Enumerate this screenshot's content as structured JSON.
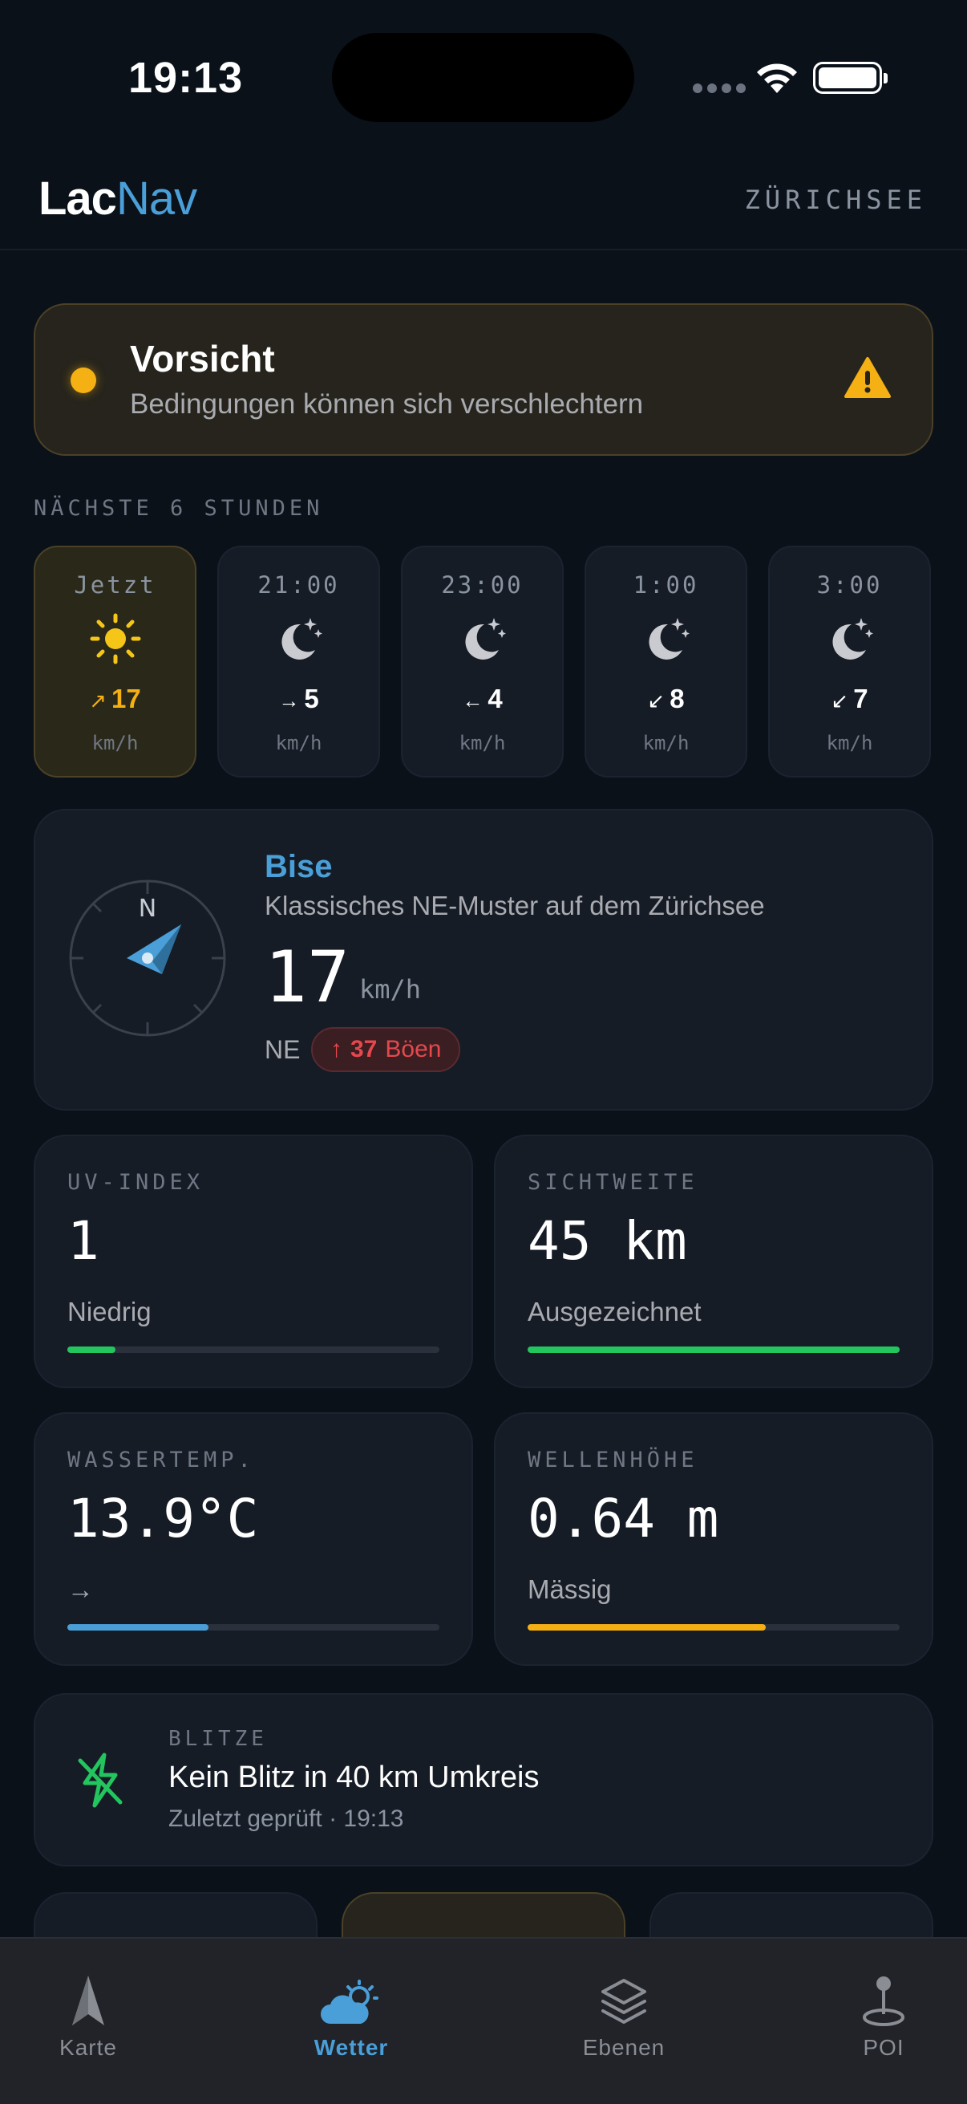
{
  "status": {
    "time": "19:13"
  },
  "header": {
    "logo_a": "Lac",
    "logo_b": "Nav",
    "lake": "ZÜRICHSEE"
  },
  "alert": {
    "title": "Vorsicht",
    "subtitle": "Bedingungen können sich verschlechtern",
    "color": "#f5b014"
  },
  "forecast": {
    "label": "NÄCHSTE 6 STUNDEN",
    "hours": [
      {
        "time": "Jetzt",
        "icon": "sun-icon",
        "arrow": "↗",
        "speed": "17",
        "unit": "km/h"
      },
      {
        "time": "21:00",
        "icon": "moon-stars-icon",
        "arrow": "→",
        "speed": "5",
        "unit": "km/h"
      },
      {
        "time": "23:00",
        "icon": "moon-stars-icon",
        "arrow": "←",
        "speed": "4",
        "unit": "km/h"
      },
      {
        "time": "1:00",
        "icon": "moon-stars-icon",
        "arrow": "↙",
        "speed": "8",
        "unit": "km/h"
      },
      {
        "time": "3:00",
        "icon": "moon-stars-icon",
        "arrow": "↙",
        "speed": "7",
        "unit": "km/h"
      }
    ]
  },
  "wind": {
    "compass_n": "N",
    "name": "Bise",
    "description": "Klassisches NE-Muster auf dem Zürichsee",
    "speed": "17",
    "unit": "km/h",
    "direction": "NE",
    "gust_arrow": "↑",
    "gust": "37",
    "gust_label": "Böen"
  },
  "stats": {
    "uv": {
      "label": "UV-INDEX",
      "value": "1",
      "sub": "Niedrig",
      "level": 0.13,
      "color": "#22c55e"
    },
    "visibility": {
      "label": "SICHTWEITE",
      "value": "45 km",
      "sub": "Ausgezeichnet",
      "level": 1.0,
      "color": "#22c55e"
    },
    "water": {
      "label": "WASSERTEMP.",
      "value": "13.9°C",
      "sub": "→",
      "level": 0.38,
      "color": "#4a9fd8"
    },
    "waves": {
      "label": "WELLENHÖHE",
      "value": "0.64 m",
      "sub": "Mässig",
      "level": 0.64,
      "color": "#f5b014"
    }
  },
  "lightning": {
    "label": "BLITZE",
    "title": "Kein Blitz in 40 km Umkreis",
    "subtitle": "Zuletzt geprüft · 19:13"
  },
  "tabs": [
    {
      "label": "Karte",
      "icon": "navigation-arrow-icon"
    },
    {
      "label": "Wetter",
      "icon": "weather-icon"
    },
    {
      "label": "Ebenen",
      "icon": "layers-icon"
    },
    {
      "label": "POI",
      "icon": "pin-icon"
    }
  ]
}
